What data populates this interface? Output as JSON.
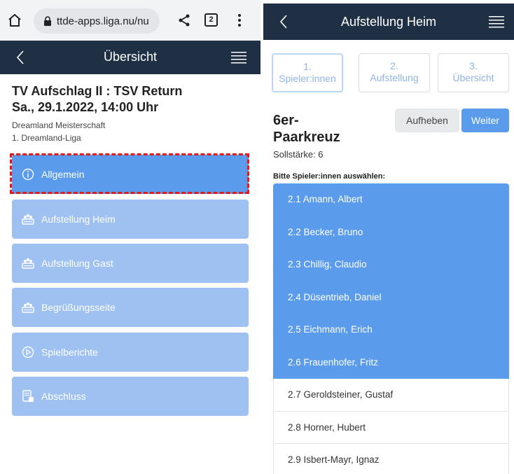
{
  "browser": {
    "url": "ttde-apps.liga.nu/nu",
    "tab_count": "2"
  },
  "left": {
    "nav_title": "Übersicht",
    "match_title": "TV Aufschlag II : TSV Return",
    "match_date": "Sa., 29.1.2022, 14:00 Uhr",
    "league_line1": "Dreamland Meisterschaft",
    "league_line2": "1. Dreamland-Liga",
    "menu": [
      {
        "label": "Allgemein",
        "icon": "info-icon"
      },
      {
        "label": "Aufstellung Heim",
        "icon": "team-icon"
      },
      {
        "label": "Aufstellung Gast",
        "icon": "team-icon"
      },
      {
        "label": "Begrüßungsseite",
        "icon": "team-icon"
      },
      {
        "label": "Spielberichte",
        "icon": "play-icon"
      },
      {
        "label": "Abschluss",
        "icon": "report-icon"
      }
    ]
  },
  "right": {
    "nav_title": "Aufstellung Heim",
    "steps": [
      {
        "num": "1.",
        "label": "Spieler:innen"
      },
      {
        "num": "2.",
        "label": "Aufstellung"
      },
      {
        "num": "3.",
        "label": "Übersicht"
      }
    ],
    "section_line1": "6er-",
    "section_line2": "Paarkreuz",
    "cancel_label": "Aufheben",
    "next_label": "Weiter",
    "target_strength": "Sollstärke: 6",
    "instruction": "Bitte Spieler:innen auswählen:",
    "players": [
      {
        "name": "2.1 Amann, Albert",
        "selected": true
      },
      {
        "name": "2.2 Becker, Bruno",
        "selected": true
      },
      {
        "name": "2.3 Chillig, Claudio",
        "selected": true
      },
      {
        "name": "2.4 Düsentrieb, Daniel",
        "selected": true
      },
      {
        "name": "2.5 Eichmann, Erich",
        "selected": true
      },
      {
        "name": "2.6 Frauenhofer, Fritz",
        "selected": true
      },
      {
        "name": "2.7 Geroldsteiner, Gustaf",
        "selected": false
      },
      {
        "name": "2.8 Horner, Hubert",
        "selected": false
      },
      {
        "name": "2.9 Isbert-Mayr, Ignaz",
        "selected": false
      }
    ]
  },
  "colors": {
    "navbar": "#1f3044",
    "accent": "#5a9bec",
    "disabled_button": "#9ec1f2",
    "highlight": "#e01b1b"
  }
}
